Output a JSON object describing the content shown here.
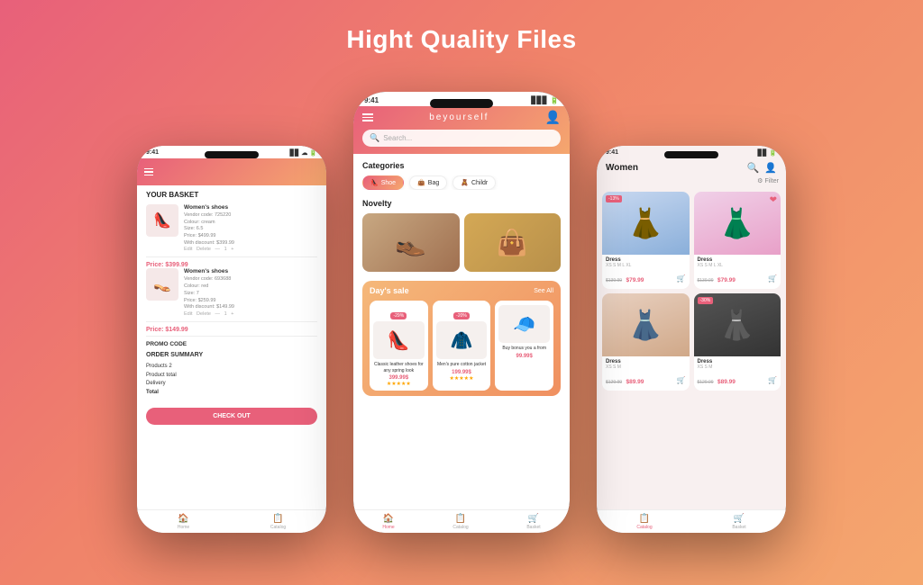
{
  "page": {
    "title": "Hight Quality Files",
    "background_gradient": "linear-gradient(135deg, #e8607a 0%, #f0836a 40%, #f5a76e 100%)"
  },
  "left_phone": {
    "time": "9:41",
    "header_icon": "☰",
    "basket_title": "YOUR BASKET",
    "items": [
      {
        "name": "Women's shoes",
        "vendor_code": "725220",
        "colour": "cream",
        "size": "6.5",
        "price": "$499.99",
        "with_discount": "$399.99",
        "display_price": "Price: $399.99",
        "emoji": "👠"
      },
      {
        "name": "Women's shoes",
        "vendor_code": "693688",
        "colour": "red",
        "size": "7",
        "price": "$259.99",
        "with_discount": "$149.99",
        "display_price": "Price: $149.99",
        "emoji": "👡"
      }
    ],
    "promo_label": "PROMO CODE",
    "order_summary_label": "ORDER SUMMARY",
    "order_lines": [
      {
        "label": "Products 2",
        "value": ""
      },
      {
        "label": "Product total",
        "value": ""
      },
      {
        "label": "Delivery",
        "value": ""
      },
      {
        "label": "Total",
        "value": ""
      }
    ],
    "checkout_btn": "CHECK OUT",
    "nav": [
      {
        "label": "Home",
        "icon": "🏠",
        "active": false
      },
      {
        "label": "Catalog",
        "icon": "📋",
        "active": false
      }
    ]
  },
  "center_phone": {
    "time": "9:41",
    "logo": "beyourself",
    "search_placeholder": "Search...",
    "categories_label": "Categories",
    "categories": [
      {
        "label": "Shoe",
        "emoji": "👠",
        "active": true
      },
      {
        "label": "Bag",
        "emoji": "👜",
        "active": false
      },
      {
        "label": "Childr",
        "emoji": "🧸",
        "active": false
      }
    ],
    "novelty_label": "Novelty",
    "novelty_items": [
      {
        "emoji": "👞",
        "bg": "brown"
      },
      {
        "emoji": "👜",
        "bg": "leopard"
      }
    ],
    "days_sale_label": "Day's sale",
    "see_all_label": "See All",
    "sale_items": [
      {
        "badge": "-29%",
        "emoji": "👠",
        "name": "Classic leather shoes for any spring look",
        "price": "399.99$",
        "stars": "★★★★★"
      },
      {
        "badge": "-20%",
        "emoji": "🕴",
        "name": "Men's pure cotton jacket",
        "price": "199.99$",
        "stars": "★★★★★"
      },
      {
        "badge": "",
        "emoji": "🧢",
        "name": "Buy bonus you a from",
        "price": "99.99$",
        "stars": ""
      }
    ],
    "nav": [
      {
        "label": "Home",
        "icon": "🏠",
        "active": true
      },
      {
        "label": "Catalog",
        "icon": "📋",
        "active": false
      },
      {
        "label": "Basket",
        "icon": "🛒",
        "active": false
      }
    ]
  },
  "right_phone": {
    "time": "9:41",
    "title": "Women",
    "filter_label": "Filter",
    "products": [
      {
        "name": "Dress",
        "size": "XS S M L XL",
        "price": "$79.99",
        "old_price": "$139.99",
        "discount": "-13%",
        "theme": "blue-dress",
        "emoji": "👗",
        "heart": false
      },
      {
        "name": "Dress",
        "size": "XS S M L XL",
        "price": "$79.99",
        "old_price": "$139.99",
        "discount": "",
        "theme": "pink-dress",
        "emoji": "👗",
        "heart": true
      },
      {
        "name": "Dress",
        "size": "XS S M",
        "price": "$89.99",
        "old_price": "$129.99",
        "discount": "",
        "theme": "nude-dress",
        "emoji": "👗",
        "heart": false
      },
      {
        "name": "Dress",
        "size": "XS S M",
        "price": "$89.99",
        "old_price": "$129.99",
        "discount": "-30%",
        "theme": "black-dress",
        "emoji": "👗",
        "heart": false
      }
    ],
    "nav": [
      {
        "label": "Catalog",
        "icon": "📋",
        "active": true
      },
      {
        "label": "Basket",
        "icon": "🛒",
        "active": false
      }
    ]
  }
}
